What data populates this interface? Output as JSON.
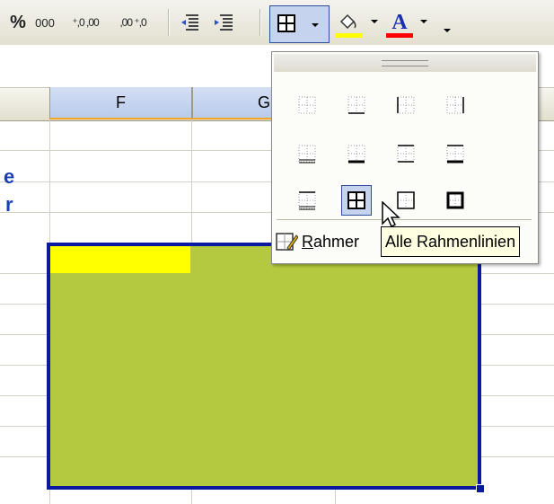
{
  "toolbar": {
    "percent_label": "%",
    "thousands_label": "000",
    "increase_decimal_label": "⁺,0 ,00",
    "decrease_decimal_label": ",00 ⁺,0",
    "icons": [
      "percent-style-icon",
      "comma-style-icon",
      "increase-decimal-icon",
      "decrease-decimal-icon",
      "decrease-indent-icon",
      "increase-indent-icon",
      "borders-icon",
      "fill-color-icon",
      "font-color-icon",
      "toolbar-options-icon"
    ],
    "fill_color": "#ffff00",
    "font_color": "#ff0000",
    "font_color_letter": "A"
  },
  "sheet": {
    "columns": [
      "F",
      "G"
    ],
    "row_label_fragments": [
      "e",
      "r"
    ],
    "fill_color": "#b5c940",
    "highlight_color": "#ffff00",
    "border_color": "#0a1aa0"
  },
  "borders_dropdown": {
    "options": [
      {
        "name": "no-border"
      },
      {
        "name": "bottom-border"
      },
      {
        "name": "left-border"
      },
      {
        "name": "right-border"
      },
      {
        "name": "bottom-double-border"
      },
      {
        "name": "thick-bottom-border"
      },
      {
        "name": "top-bottom-border"
      },
      {
        "name": "top-thick-bottom-border"
      },
      {
        "name": "top-double-bottom-border"
      },
      {
        "name": "all-borders",
        "selected": true
      },
      {
        "name": "outside-borders"
      },
      {
        "name": "thick-box-border"
      }
    ],
    "draw_borders_label_prefix": "R",
    "draw_borders_label_rest": "ahmer",
    "tooltip": "Alle Rahmenlinien"
  }
}
